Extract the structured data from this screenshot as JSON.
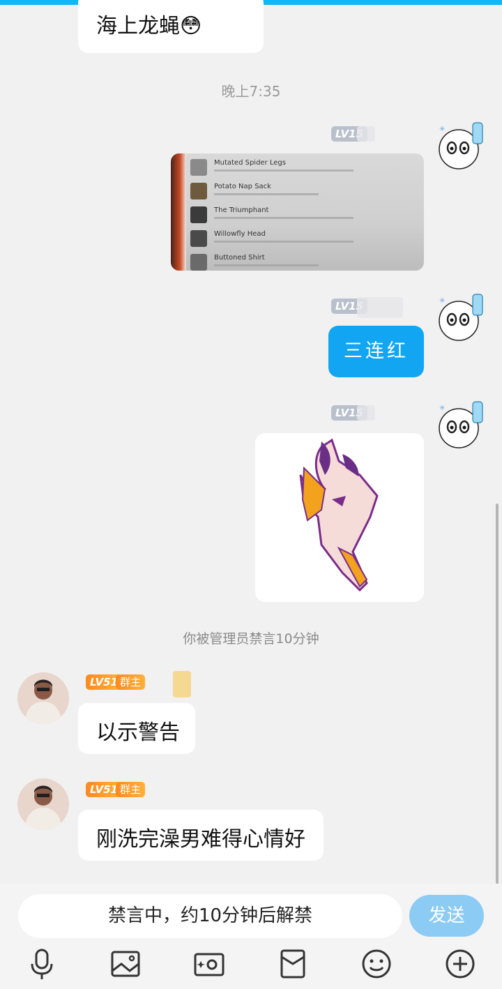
{
  "messages": {
    "top_partial": {
      "text": "海上龙蝇😳"
    },
    "time_label": "晚上7:35",
    "self": {
      "level": "LV15",
      "items": [
        {
          "name": "Mutated Spider Legs"
        },
        {
          "name": "Potato Nap Sack"
        },
        {
          "name": "The Triumphant"
        },
        {
          "name": "Willowfly Head"
        },
        {
          "name": "Buttoned Shirt"
        }
      ],
      "text_message": "三连红"
    },
    "system_notice": "你被管理员禁言10分钟",
    "other": {
      "level": "LV51",
      "role": "群主",
      "messages": [
        "以示警告",
        "刚洗完澡男难得心情好"
      ]
    }
  },
  "input": {
    "placeholder": "禁言中，约10分钟后解禁",
    "send_label": "发送"
  },
  "toolbar": {
    "icons": [
      "microphone-icon",
      "image-icon",
      "camera-icon",
      "red-packet-icon",
      "emoji-icon",
      "plus-icon"
    ]
  },
  "colors": {
    "accent": "#12b7f5",
    "bubble_blue": "#12a5f2",
    "send_button": "#8ccbf3",
    "level_orange": "#ff8a1f"
  }
}
